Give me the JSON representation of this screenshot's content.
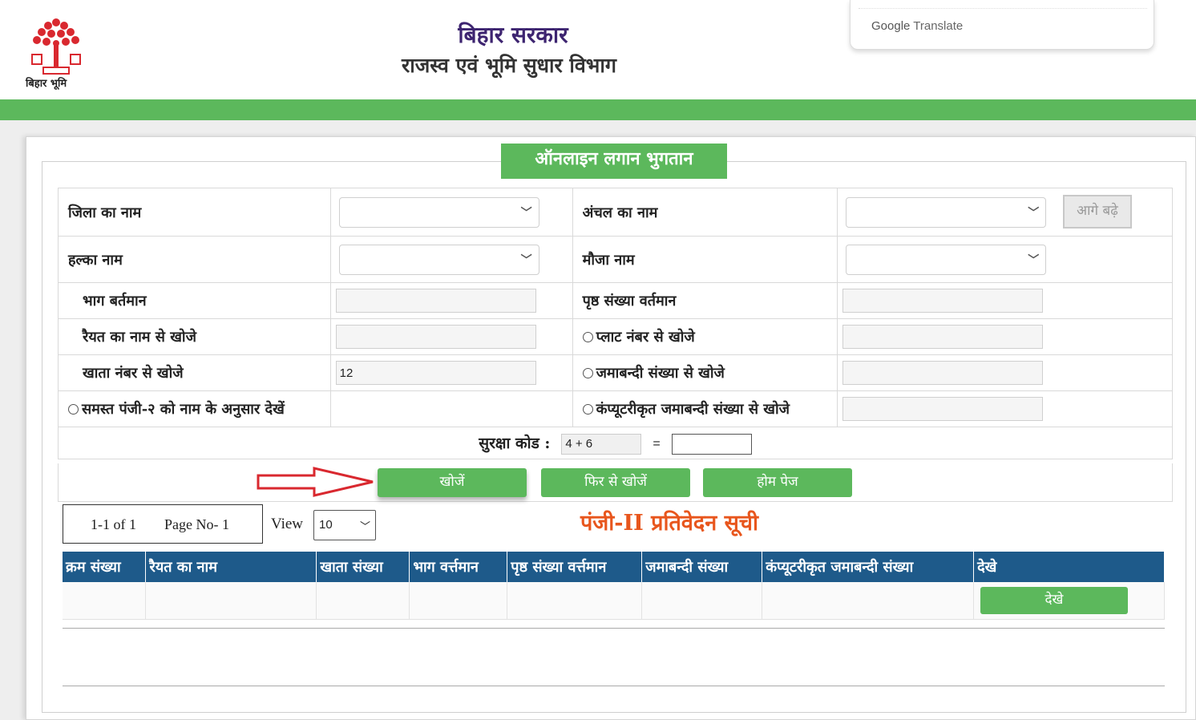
{
  "header": {
    "logo_caption": "बिहार भूमि",
    "title_main": "बिहार सरकार",
    "title_sub": "राजस्व एवं भूमि सुधार विभाग",
    "translate_google": "Google",
    "translate_label": " Translate"
  },
  "form": {
    "legend": "ऑनलाइन लगान भुगतान",
    "district_label": "जिला का नाम",
    "circle_label": "अंचल का नाम",
    "next_button": "आगे बढ़े",
    "halka_label": "हल्का नाम",
    "mauja_label": "मौजा नाम",
    "bhag_label": "भाग बर्तमान",
    "prishth_label": "पृष्ठ संख्या वर्तमान",
    "raiyat_label": "रैयत का नाम से खोजे",
    "plot_label": "प्लाट नंबर से खोजे",
    "khata_label": "खाता नंबर से खोजे",
    "khata_value": "12",
    "jamabandi_label": "जमाबन्दी संख्या से खोजे",
    "samast_label": "समस्त पंजी-२ को नाम के अनुसार देखें",
    "computer_jamabandi_label": "कंप्यूटरीकृत जमाबन्दी संख्या से खोजे",
    "captcha_label": "सुरक्षा कोड :",
    "captcha_question": "4 + 6",
    "captcha_equals": "="
  },
  "buttons": {
    "search": "खोजें",
    "search_again": "फिर से खोजें",
    "home": "होम पेज",
    "view_row": "देखे"
  },
  "pager": {
    "range": "1-1 of 1",
    "page": "Page No- 1",
    "view_label": "View",
    "view_value": "10"
  },
  "report": {
    "title": "पंजी-II प्रतिवेदन सूची",
    "columns": [
      "क्रम संख्या",
      "रैयत का नाम",
      "खाता संख्या",
      "भाग वर्त्तमान",
      "पृष्ठ संख्या वर्त्तमान",
      "जमाबन्दी संख्या",
      "कंप्यूटरीकृत जमाबन्दी संख्या",
      "देखे"
    ]
  },
  "colors": {
    "green": "#5cb85c",
    "table_header": "#1e5a8a",
    "report_title": "#e8561d",
    "title_purple": "#3d2470",
    "arrow_red": "#d9282f"
  }
}
